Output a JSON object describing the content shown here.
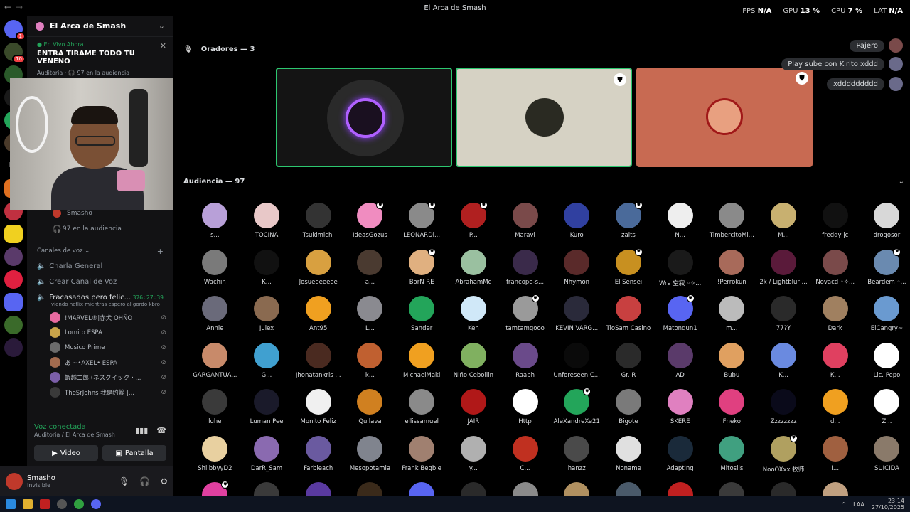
{
  "window": {
    "title": "El Arca de Smash"
  },
  "stats": [
    {
      "label": "FPS",
      "value": "N/A"
    },
    {
      "label": "GPU",
      "value": "13 %"
    },
    {
      "label": "CPU",
      "value": "7 %"
    },
    {
      "label": "LAT",
      "value": "N/A"
    }
  ],
  "server_rail": {
    "home_badge": "1",
    "second_badge": "10",
    "ps_label": "PS"
  },
  "sidebar": {
    "server_name": "El Arca de Smash",
    "live": {
      "status": "En Vivo Ahora",
      "title": "ENTRA TIRAME TODO TU VENENO",
      "channel": "Auditoria",
      "audience": "97 en la audiencia"
    },
    "stage_items": [
      {
        "label": "Smasho"
      },
      {
        "label": "97 en la audiencia"
      }
    ],
    "voice_category": "Canales de voz",
    "voice_channels": [
      {
        "label": "Charla General"
      },
      {
        "label": "Crear Canal de Voz"
      },
      {
        "label": "Fracasados pero felic...",
        "timer": "376:27:39",
        "activity": "viendo neflix mientras espero al gordo kbro"
      }
    ],
    "voice_users": [
      {
        "name": "!MARVEL®|赤犬 OHÑO",
        "color": "#e86aa0"
      },
      {
        "name": "Lomito ESPA",
        "color": "#c9a44a"
      },
      {
        "name": "Musico Prime",
        "color": "#6b6b6b"
      },
      {
        "name": "あ ~•AXEL• ESPA",
        "color": "#a36b4f"
      },
      {
        "name": "蝦越二郎 (ネスクイック・...",
        "color": "#7b5ea8"
      },
      {
        "name": "TheSrJohns 我是约翰 |...",
        "color": "#3a3a3a"
      }
    ]
  },
  "voice_panel": {
    "status": "Voz conectada",
    "location": "Auditoria / El Arca de Smash",
    "video_label": "Video",
    "screen_label": "Pantalla"
  },
  "user_panel": {
    "name": "Smasho",
    "status": "Invisible"
  },
  "stage": {
    "speakers_header": "Oradores — 3",
    "audience_header": "Audiencia — 97",
    "tiles": [
      {
        "bg": "#141414"
      },
      {
        "bg": "#d6d2c4"
      },
      {
        "bg": "#c86a52"
      }
    ]
  },
  "chat": [
    {
      "text": "Pajero"
    },
    {
      "text": "Play sube con Kirito xddd"
    },
    {
      "text": "xddddddddd"
    }
  ],
  "audience": [
    {
      "name": "s...",
      "c": "#b8a0d8",
      "s": false
    },
    {
      "name": "TOCINA",
      "c": "#e8c8c8",
      "s": false
    },
    {
      "name": "Tsukimichi",
      "c": "#333333",
      "s": false
    },
    {
      "name": "IdeasGozus",
      "c": "#f08cc0",
      "s": true
    },
    {
      "name": "LEONARDi...",
      "c": "#8a8a8a",
      "s": true
    },
    {
      "name": "P...",
      "c": "#b02020",
      "s": true
    },
    {
      "name": "Maravi",
      "c": "#7a4a4a",
      "s": false
    },
    {
      "name": "Kuro",
      "c": "#3040a0",
      "s": false
    },
    {
      "name": "zalts",
      "c": "#4a6a9a",
      "s": true
    },
    {
      "name": "N...",
      "c": "#eeeeee",
      "s": false
    },
    {
      "name": "TimbercitoMi...",
      "c": "#8a8a8a",
      "s": false
    },
    {
      "name": "M...",
      "c": "#c8b070",
      "s": false
    },
    {
      "name": "freddy jc",
      "c": "#111111",
      "s": false
    },
    {
      "name": "drogosor",
      "c": "#d8d8d8",
      "s": false
    },
    {
      "name": "Wachin",
      "c": "#7a7a7a",
      "s": false
    },
    {
      "name": "K...",
      "c": "#111111",
      "s": false
    },
    {
      "name": "Josueeeeeee",
      "c": "#d8a040",
      "s": false
    },
    {
      "name": "a...",
      "c": "#4a3a30",
      "s": false
    },
    {
      "name": "BorN RE",
      "c": "#e0b080",
      "s": true
    },
    {
      "name": "AbrahamMc",
      "c": "#9ac0a0",
      "s": false
    },
    {
      "name": "francope-s...",
      "c": "#3a2a4a",
      "s": false
    },
    {
      "name": "Nhymon",
      "c": "#5a2a2a",
      "s": false
    },
    {
      "name": "El Sensei",
      "c": "#c89020",
      "s": true
    },
    {
      "name": "Wra 空寂 ◦✧...",
      "c": "#1a1a1a",
      "s": false
    },
    {
      "name": "!Perrokun",
      "c": "#a86a5a",
      "s": false
    },
    {
      "name": "2k / Lightblur ...",
      "c": "#5a1a3a",
      "s": false
    },
    {
      "name": "Novacd ◦✧...",
      "c": "#7a4a4a",
      "s": false
    },
    {
      "name": "Beardem ◦...",
      "c": "#6a8ab0",
      "s": true
    },
    {
      "name": "Annie",
      "c": "#6a6a7a",
      "s": false
    },
    {
      "name": "Julex",
      "c": "#8a6a50",
      "s": false
    },
    {
      "name": "Ant95",
      "c": "#f0a020",
      "s": false
    },
    {
      "name": "L...",
      "c": "#8a8a90",
      "s": false
    },
    {
      "name": "Sander",
      "c": "#23a55a",
      "s": false
    },
    {
      "name": "Ken",
      "c": "#d0e8f8",
      "s": false
    },
    {
      "name": "tamtamgooo",
      "c": "#9a9a9a",
      "s": true
    },
    {
      "name": "KEVIN VARG...",
      "c": "#2a2a3a",
      "s": false
    },
    {
      "name": "TioSam Casino",
      "c": "#c84040",
      "s": false
    },
    {
      "name": "Matonqun1",
      "c": "#5865f2",
      "s": true
    },
    {
      "name": "m...",
      "c": "#bbbbbb",
      "s": false
    },
    {
      "name": "77?Y",
      "c": "#2a2a2a",
      "s": false
    },
    {
      "name": "Dark",
      "c": "#a08060",
      "s": false
    },
    {
      "name": "ElCangry~",
      "c": "#6a9ad0",
      "s": false
    },
    {
      "name": "GARGANTUA...",
      "c": "#c88a6a",
      "s": false
    },
    {
      "name": "G...",
      "c": "#40a0d0",
      "s": false
    },
    {
      "name": "Jhonatankris ...",
      "c": "#4a2a20",
      "s": false
    },
    {
      "name": "k...",
      "c": "#c06030",
      "s": false
    },
    {
      "name": "MichaelMaki",
      "c": "#f0a020",
      "s": false
    },
    {
      "name": "Niño Cebollin",
      "c": "#80b060",
      "s": false
    },
    {
      "name": "Raabh",
      "c": "#6a4a8a",
      "s": false
    },
    {
      "name": "Unforeseen C...",
      "c": "#0a0a0a",
      "s": false
    },
    {
      "name": "Gr. R",
      "c": "#2a2a2a",
      "s": false
    },
    {
      "name": "AD",
      "c": "#5a3a6a",
      "s": false
    },
    {
      "name": "Bubu",
      "c": "#e0a060",
      "s": false
    },
    {
      "name": "K...",
      "c": "#6a8ae0",
      "s": false
    },
    {
      "name": "K...",
      "c": "#e04060",
      "s": false
    },
    {
      "name": "Lic. Pepo",
      "c": "#ffffff",
      "s": false
    },
    {
      "name": "luhe",
      "c": "#3a3a3a",
      "s": false
    },
    {
      "name": "Luman Pee",
      "c": "#1a1a2a",
      "s": false
    },
    {
      "name": "Monito Feliz",
      "c": "#f0f0f0",
      "s": false
    },
    {
      "name": "Quilava",
      "c": "#d08020",
      "s": false
    },
    {
      "name": "ellissamuel",
      "c": "#8a8a8a",
      "s": false
    },
    {
      "name": "JAIR",
      "c": "#b01818",
      "s": false
    },
    {
      "name": "Http",
      "c": "#ffffff",
      "s": false
    },
    {
      "name": "AleXandreXe21",
      "c": "#23a55a",
      "s": true
    },
    {
      "name": "Bigote",
      "c": "#7a7a7a",
      "s": false
    },
    {
      "name": "SKERE",
      "c": "#e080c0",
      "s": false
    },
    {
      "name": "Fneko",
      "c": "#e04080",
      "s": false
    },
    {
      "name": "Zzzzzzzz",
      "c": "#0a0a1a",
      "s": false
    },
    {
      "name": "d...",
      "c": "#f0a020",
      "s": false
    },
    {
      "name": "Z...",
      "c": "#ffffff",
      "s": false
    },
    {
      "name": "ShiibbyyD2",
      "c": "#e8d0a0",
      "s": false
    },
    {
      "name": "DarR_Sam",
      "c": "#8a6ab0",
      "s": false
    },
    {
      "name": "Farbleach",
      "c": "#6a5aa0",
      "s": false
    },
    {
      "name": "Mesopotamia",
      "c": "#80848e",
      "s": false
    },
    {
      "name": "Frank Begbie",
      "c": "#a08070",
      "s": false
    },
    {
      "name": "y...",
      "c": "#b0b0b0",
      "s": false
    },
    {
      "name": "C...",
      "c": "#c03020",
      "s": false
    },
    {
      "name": "hanzz",
      "c": "#4a4a4a",
      "s": false
    },
    {
      "name": "Noname",
      "c": "#e0e0e0",
      "s": false
    },
    {
      "name": "Adapting",
      "c": "#1a2a3a",
      "s": false
    },
    {
      "name": "Mitosiis",
      "c": "#40a080",
      "s": false
    },
    {
      "name": "NooOXxx 牧师",
      "c": "#b0a060",
      "s": true
    },
    {
      "name": "I...",
      "c": "#a06040",
      "s": false
    },
    {
      "name": "SUICIDA",
      "c": "#8a7a6a",
      "s": false
    },
    {
      "name": "",
      "c": "#e040a0",
      "s": true
    },
    {
      "name": "",
      "c": "#3a3a3a",
      "s": false
    },
    {
      "name": "",
      "c": "#5a3aa0",
      "s": false
    },
    {
      "name": "",
      "c": "#3a2a1a",
      "s": false
    },
    {
      "name": "",
      "c": "#5865f2",
      "s": false
    },
    {
      "name": "",
      "c": "#2a2a2a",
      "s": false
    },
    {
      "name": "",
      "c": "#8a8a8a",
      "s": false
    },
    {
      "name": "",
      "c": "#b09060",
      "s": false
    },
    {
      "name": "",
      "c": "#4a5a6a",
      "s": false
    },
    {
      "name": "",
      "c": "#c02020",
      "s": false
    },
    {
      "name": "",
      "c": "#3a3a3a",
      "s": false
    },
    {
      "name": "",
      "c": "#2a2a2a",
      "s": false
    },
    {
      "name": "",
      "c": "#c0a080",
      "s": false
    }
  ],
  "taskbar": {
    "lang": "LAA",
    "time": "23:14",
    "date": "27/10/2025"
  }
}
